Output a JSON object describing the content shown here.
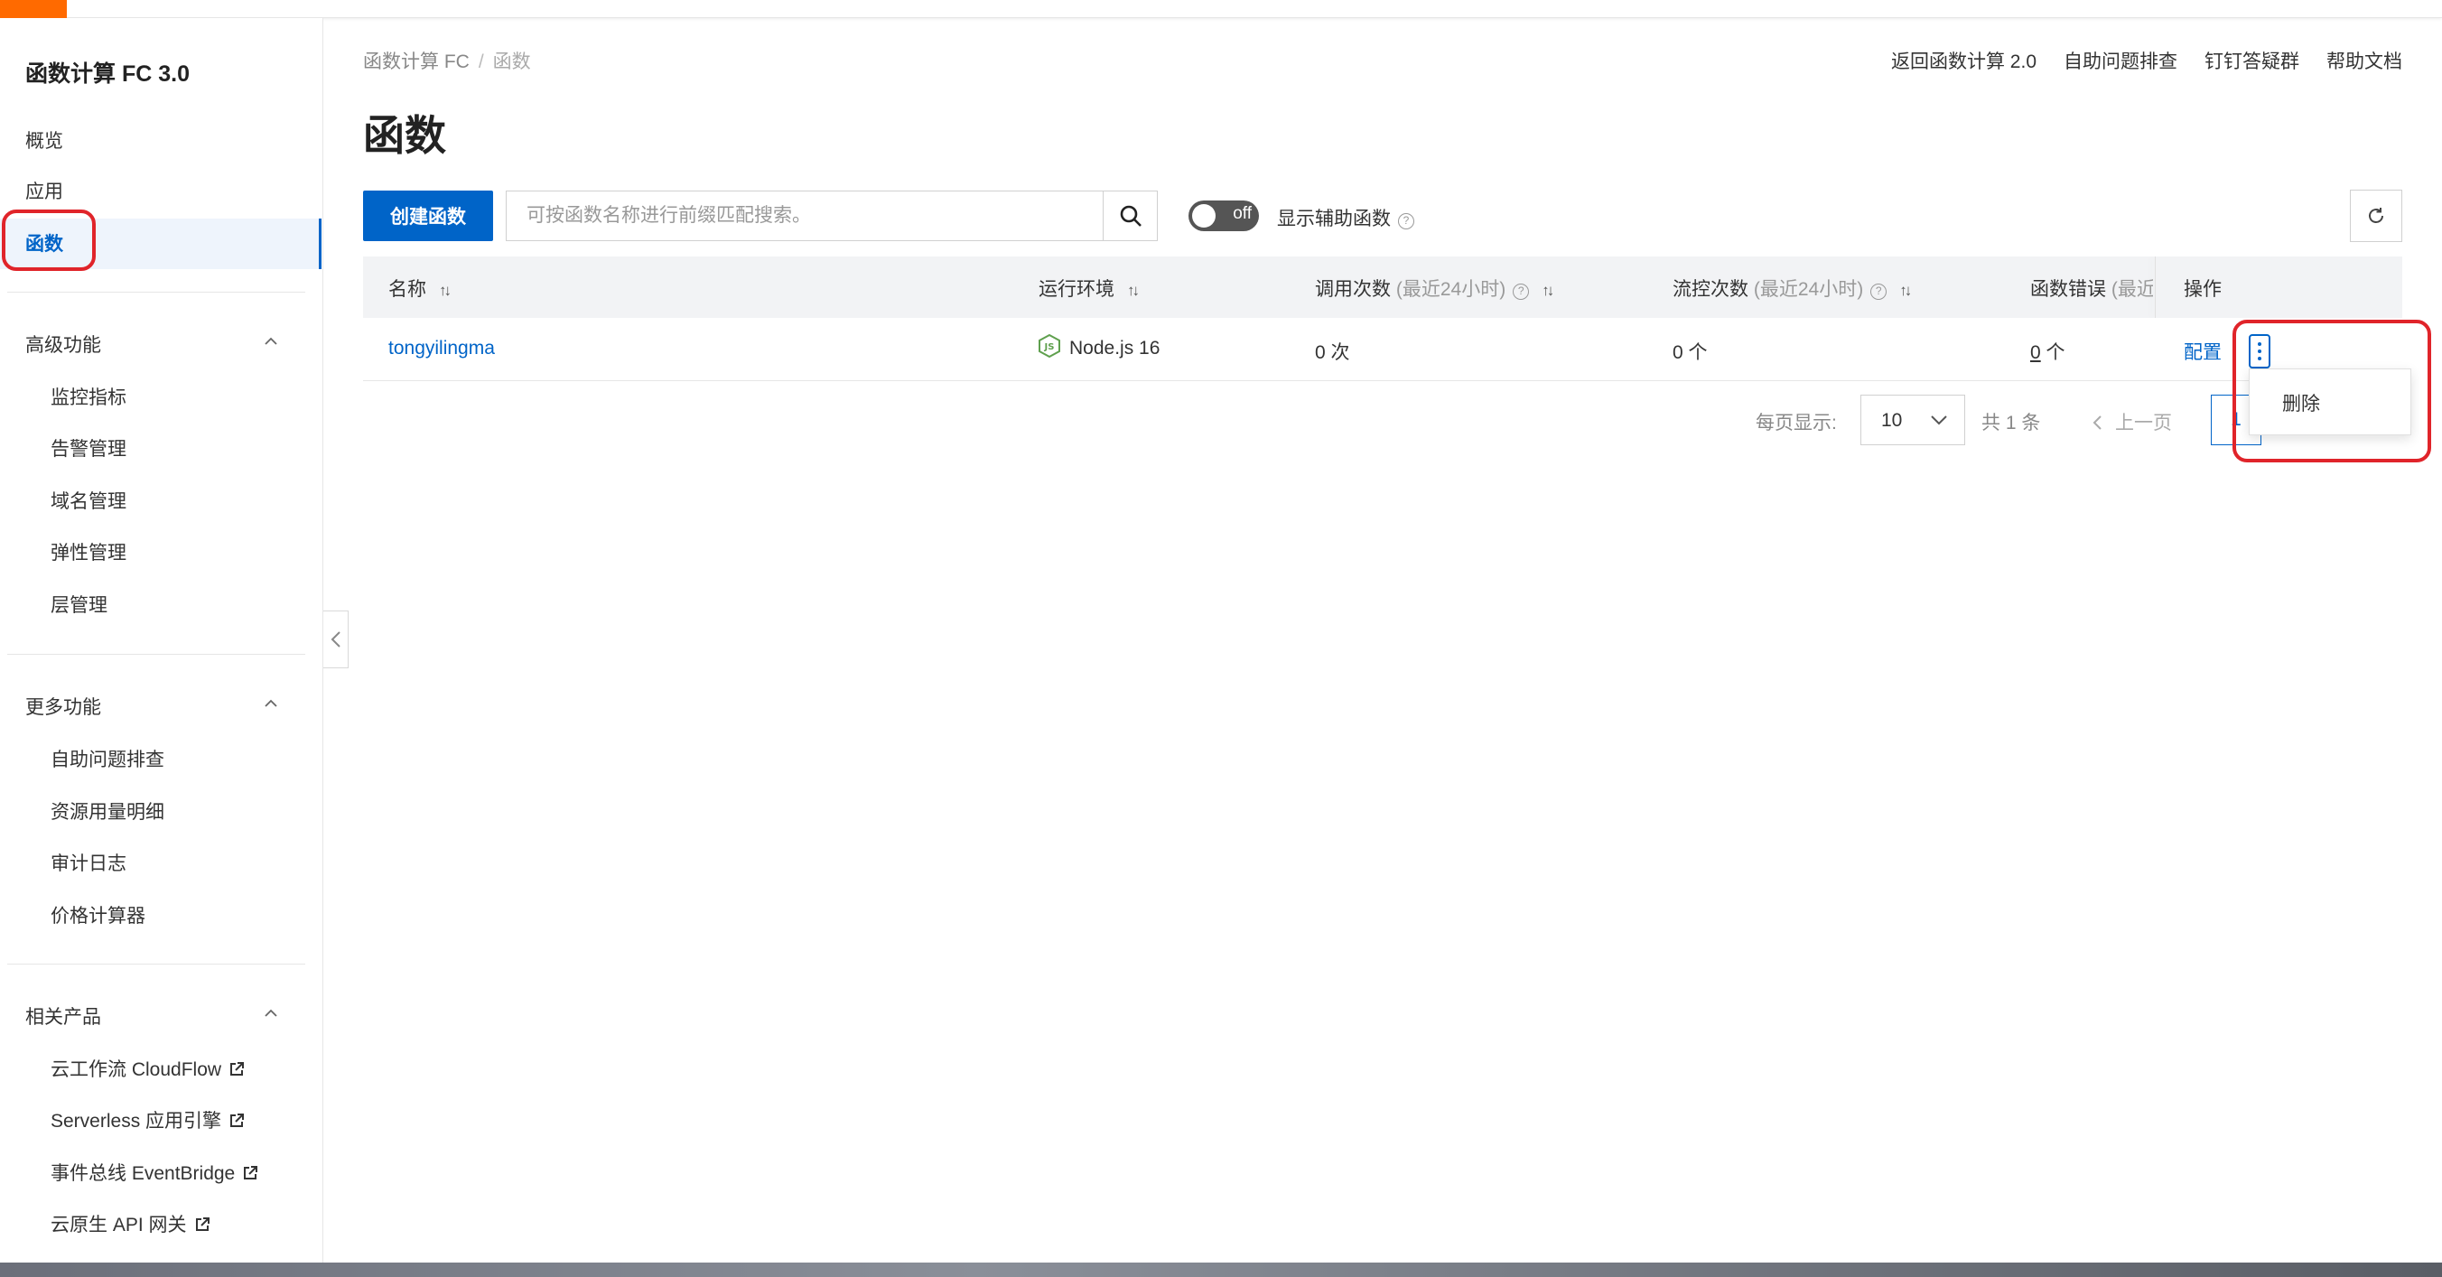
{
  "sidebar": {
    "title": "函数计算 FC 3.0",
    "overview": "概览",
    "apps": "应用",
    "functions": "函数",
    "advanced": {
      "label": "高级功能",
      "items": [
        "监控指标",
        "告警管理",
        "域名管理",
        "弹性管理",
        "层管理"
      ]
    },
    "more": {
      "label": "更多功能",
      "items": [
        "自助问题排查",
        "资源用量明细",
        "审计日志",
        "价格计算器"
      ]
    },
    "related": {
      "label": "相关产品",
      "items": [
        "云工作流 CloudFlow",
        "Serverless 应用引擎",
        "事件总线 EventBridge",
        "云原生 API 网关"
      ]
    }
  },
  "breadcrumb": {
    "root": "函数计算 FC",
    "sep": "/",
    "current": "函数"
  },
  "header_links": [
    "返回函数计算 2.0",
    "自助问题排查",
    "钉钉答疑群",
    "帮助文档"
  ],
  "page_title": "函数",
  "toolbar": {
    "create_label": "创建函数",
    "search_placeholder": "可按函数名称进行前缀匹配搜索。",
    "toggle_text": "off",
    "toggle_label": "显示辅助函数",
    "help_glyph": "?"
  },
  "table": {
    "headers": {
      "name": "名称",
      "runtime": "运行环境",
      "invocations": "调用次数",
      "invocations_note": "(最近24小时)",
      "throttles": "流控次数",
      "throttles_note": "(最近24小时)",
      "errors": "函数错误",
      "errors_note": "(最近",
      "ops": "操作"
    },
    "sort_glyph": "↑↓",
    "rows": [
      {
        "name": "tongyilingma",
        "runtime": "Node.js 16",
        "invocations": "0 次",
        "throttles": "0 个",
        "errors_num": "0",
        "errors_unit": " 个",
        "config": "配置"
      }
    ]
  },
  "dropdown": {
    "delete": "删除"
  },
  "pagination": {
    "per_page_label": "每页显示:",
    "per_page_value": "10",
    "total": "共 1 条",
    "prev": "上一页",
    "current": "1"
  },
  "colors": {
    "primary": "#0064c8",
    "brand": "#ff6a00",
    "annotation": "#e0242a"
  }
}
